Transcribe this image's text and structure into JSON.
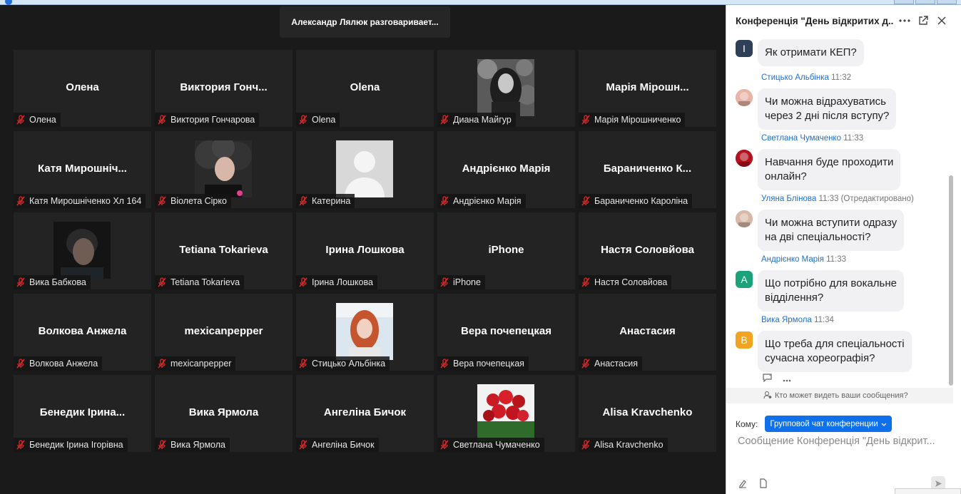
{
  "speaker_banner": "Александр Лялюк разговаривает...",
  "tiles": [
    {
      "big": "Олена",
      "label": "Олена"
    },
    {
      "big": "Виктория  Гонч...",
      "label": "Виктория Гончарова"
    },
    {
      "big": "Olena",
      "label": "Olena"
    },
    {
      "big": "",
      "label": "Диана Майгур",
      "photo": "photo-monochrome-girl-flowers"
    },
    {
      "big": "Марія  Мірошн...",
      "label": "Марія Мірошниченко"
    },
    {
      "big": "Катя  Мирошніч...",
      "label": "Катя Мирошніченко Хл 164"
    },
    {
      "big": "",
      "label": "Віолета Сірко",
      "photo": "photo-curly-hair-girl"
    },
    {
      "big": "",
      "label": "Катерина",
      "photo": "default-avatar"
    },
    {
      "big": "Андрієнко  Марія",
      "label": "Андрієнко Марія"
    },
    {
      "big": "Бараниченко  К...",
      "label": "Бараниченко Кароліна"
    },
    {
      "big": "",
      "label": "Вика Бабкова",
      "photo": "photo-dark-portrait"
    },
    {
      "big": "Tetiana Tokarieva",
      "label": "Tetiana Tokarieva"
    },
    {
      "big": "Ірина Лошкова",
      "label": "Ірина Лошкова"
    },
    {
      "big": "iPhone",
      "label": "iPhone"
    },
    {
      "big": "Настя Соловйова",
      "label": "Настя Соловйова"
    },
    {
      "big": "Волкова Анжела",
      "label": "Волкова Анжела"
    },
    {
      "big": "mexicanpepper",
      "label": "mexicanpepper"
    },
    {
      "big": "",
      "label": "Стицько Альбінка",
      "photo": "photo-redhead-girl"
    },
    {
      "big": "Вера почепецкая",
      "label": "Вера почепецкая"
    },
    {
      "big": "Анастасия",
      "label": "Анастасия"
    },
    {
      "big": "Бенедик Ірина...",
      "label": "Бенедик Ірина Ігорівна"
    },
    {
      "big": "Вика Ярмола",
      "label": "Вика Ярмола"
    },
    {
      "big": "Ангеліна Бичок",
      "label": "Ангеліна Бичок"
    },
    {
      "big": "",
      "label": "Светлана Чумаченко",
      "photo": "photo-red-roses"
    },
    {
      "big": "Alisa Kravchenko",
      "label": "Alisa Kravchenko"
    }
  ],
  "chat": {
    "title": "Конференція \"День відкритих д...",
    "icons": {
      "more": "more-icon",
      "popout": "popout-icon",
      "close": "close-icon"
    },
    "messages": [
      {
        "sender": "",
        "time": "",
        "edited": "",
        "avatar_letter": "I",
        "avatar_color": "#2f3f57",
        "text_lines": [
          "Як отримати КЕП?"
        ]
      },
      {
        "sender": "Стицько Альбінка",
        "time": "11:32",
        "edited": "",
        "avatar_letter": "",
        "avatar_color": "#e8b4a6",
        "text_lines": [
          "Чи можна відрахуватись",
          "через 2 дні після вступу?"
        ]
      },
      {
        "sender": "Светлана Чумаченко",
        "time": "11:33",
        "edited": "",
        "avatar_letter": "",
        "avatar_color": "#b3121f",
        "text_lines": [
          "Навчання буде проходити",
          "онлайн?"
        ]
      },
      {
        "sender": "Уляна Блінова",
        "time": "11:33",
        "edited": "(Отредактировано)",
        "avatar_letter": "",
        "avatar_color": "#d8b8a8",
        "text_lines": [
          "Чи можна вступити одразу",
          "на дві спеціальності?"
        ]
      },
      {
        "sender": "Андрієнко Марія",
        "time": " 11:33",
        "edited": "",
        "avatar_letter": "A",
        "avatar_color": "#1aa37a",
        "text_lines": [
          "Що потрібно для вокальне",
          "відділення?"
        ]
      },
      {
        "sender": "Вика Ярмола",
        "time": "11:34",
        "edited": "",
        "avatar_letter": "B",
        "avatar_color": "#f0a422",
        "text_lines": [
          "Що треба для спеціальності",
          "сучасна хореографія?"
        ]
      }
    ],
    "visibility_text": "Кто может видеть ваши сообщения?",
    "to_label": "Кому:",
    "to_value": "Групповой чат конференции",
    "compose_placeholder": "Сообщение Конференція \"День відкрит..."
  }
}
